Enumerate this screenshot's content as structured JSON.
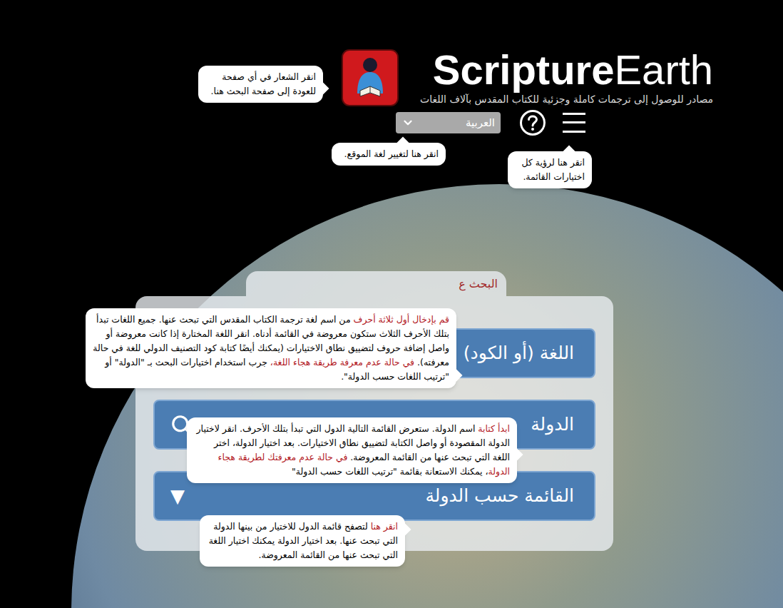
{
  "header": {
    "title_bold": "Scripture",
    "title_light": "Earth",
    "subtitle": "مصادر للوصول إلى ترجمات كاملة وجزئية للكتاب المقدس بآلاف اللغات",
    "language_select": {
      "value": "العربية"
    }
  },
  "search_panel": {
    "tab_label": "البحث ع",
    "fields": [
      {
        "kind": "input",
        "label": "اللغة (أو الكود)"
      },
      {
        "kind": "search",
        "label": "الدولة"
      },
      {
        "kind": "dropdown",
        "label": "القائمة حسب الدولة",
        "icon": "▼"
      }
    ]
  },
  "callouts": [
    {
      "target": "logo",
      "segments": [
        {
          "text": "انقر الشعار في أي صفحة للعودة إلى صفحة البحث هنا.",
          "highlight": false
        }
      ]
    },
    {
      "target": "language-select",
      "segments": [
        {
          "text": "انقر هنا لتغيير لغة الموقع.",
          "highlight": false
        }
      ]
    },
    {
      "target": "menu",
      "segments": [
        {
          "text": "انقر هنا لرؤية كل اختيارات القائمة.",
          "highlight": false
        }
      ]
    },
    {
      "target": "language-field",
      "segments": [
        {
          "text": "قم بإدخال أول ثلاثة أحرف",
          "highlight": true
        },
        {
          "text": " من اسم لغة ترجمة الكتاب المقدس التي تبحث عنها. جميع اللغات تبدأ بتلك الأحرف الثلاث ستكون معروضة في القائمة أدناه. انقر اللغة المختارة إذا كانت معروضة أو واصل إضافة حروف لتضييق نطاق الاختيارات (يمكنك أيضًا كتابة كود التصنيف الدولي للغة في حالة معرفته). ",
          "highlight": false
        },
        {
          "text": "في حالة عدم معرفة طريقة هجاء اللغة،",
          "highlight": true
        },
        {
          "text": " جرب استخدام اختيارات البحث بـ \"الدولة\" أو \"ترتيب اللغات حسب الدولة\".",
          "highlight": false
        }
      ]
    },
    {
      "target": "country-field",
      "segments": [
        {
          "text": "ابدأ كتابة",
          "highlight": true
        },
        {
          "text": " اسم الدولة. ستعرض القائمة التالية الدول التي تبدأ بتلك الأحرف. انقر لاختيار الدولة المقصودة أو واصل الكتابة لتضييق نطاق الاختيارات. بعد اختيار الدولة، اختر اللغة التي تبحث عنها من القائمة المعروضة. ",
          "highlight": false
        },
        {
          "text": "في حالة عدم معرفتك لطريقة هجاء الدولة",
          "highlight": true
        },
        {
          "text": "، يمكنك الاستعانة بقائمة \"ترتيب اللغات حسب الدولة\"",
          "highlight": false
        }
      ]
    },
    {
      "target": "country-list",
      "segments": [
        {
          "text": "انقر هنا",
          "highlight": true
        },
        {
          "text": " لتصفح قائمة الدول للاختيار من بينها الدولة التي تبحث عنها. بعد اختيار الدولة يمكنك اختيار اللغة التي تبحث عنها من القائمة المعروضة.",
          "highlight": false
        }
      ]
    }
  ]
}
